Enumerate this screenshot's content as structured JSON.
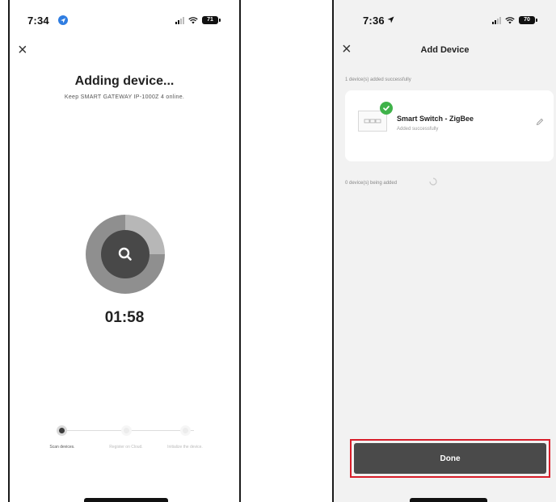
{
  "left_screen": {
    "status": {
      "time": "7:34",
      "battery": "71"
    },
    "title": "Adding device...",
    "subtitle": "Keep SMART GATEWAY IP-1000Z 4 online.",
    "countdown": "01:58",
    "steps": [
      {
        "label": "Scan devices."
      },
      {
        "label": "Register on Cloud."
      },
      {
        "label": "Initialize the device."
      }
    ]
  },
  "right_screen": {
    "status": {
      "time": "7:36",
      "battery": "70"
    },
    "title": "Add Device",
    "added_success_text": "1 device(s) added successfully",
    "device": {
      "name": "Smart Switch - ZigBee",
      "status": "Added successfully"
    },
    "being_added_text": "0 device(s) being added",
    "done_label": "Done"
  },
  "colors": {
    "accent_dark": "#4a4a4a",
    "success_green": "#3fb24a",
    "highlight_red": "#d81e2a"
  },
  "icons": {
    "scan": "search-icon",
    "close": "close-icon",
    "edit": "pencil-icon",
    "check": "check-icon"
  }
}
